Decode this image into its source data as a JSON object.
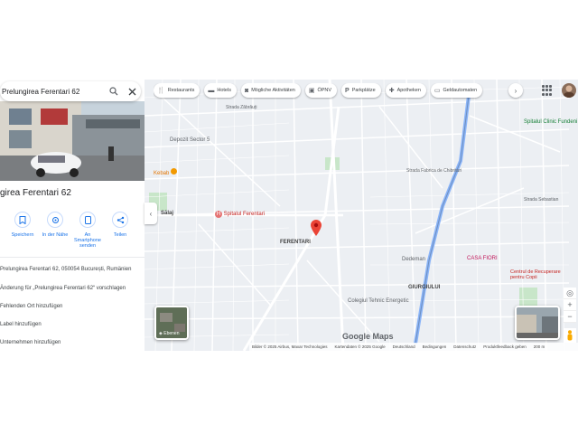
{
  "search": {
    "query": "Prelungirea Ferentari 62"
  },
  "place": {
    "title": "Prelungirea Ferentari 62",
    "title_visible": "girea Ferentari 62"
  },
  "actions": [
    {
      "label": "Speichern",
      "icon": "bookmark-icon"
    },
    {
      "label": "In der Nähe",
      "icon": "nearby-icon"
    },
    {
      "label": "An Smartphone senden",
      "icon": "send-to-phone-icon"
    },
    {
      "label": "Teilen",
      "icon": "share-icon"
    }
  ],
  "info": {
    "address": "Prelungirea Ferentari 62, 050054 București, Rumänien",
    "suggest_edit": "Änderung für „Prelungirea Ferentari 62“ vorschlagen",
    "add_missing": "Fehlenden Ort hinzufügen",
    "add_label": "Label hinzufügen",
    "add_business": "Unternehmen hinzufügen"
  },
  "chips": [
    {
      "label": "Restaurants",
      "icon": "fork-knife-icon"
    },
    {
      "label": "Hotels",
      "icon": "bed-icon"
    },
    {
      "label": "Mögliche Aktivitäten",
      "icon": "camera-icon"
    },
    {
      "label": "ÖPNV",
      "icon": "transit-icon"
    },
    {
      "label": "Parkplätze",
      "icon": "parking-icon"
    },
    {
      "label": "Apotheken",
      "icon": "pharmacy-icon"
    },
    {
      "label": "Geldautomaten",
      "icon": "atm-icon"
    }
  ],
  "map": {
    "labels": [
      {
        "text": "Spitalul Clinic Fundeni",
        "name": "poi"
      },
      {
        "text": "Sălaj",
        "name": "area"
      },
      {
        "text": "FERENTARI",
        "name": "area"
      },
      {
        "text": "GIURGIULUI",
        "name": "area"
      },
      {
        "text": "Spitalul Ferentari",
        "name": "hospital"
      },
      {
        "text": "Școala Gimnazială nr. 136",
        "name": "school"
      },
      {
        "text": "Colegiul Tehnic Energetic",
        "name": "school"
      },
      {
        "text": "CASA FIORI",
        "name": "poi"
      },
      {
        "text": "Centrul de Recuperare pentru Copii",
        "name": "poi"
      },
      {
        "text": "Dedeman",
        "name": "poi"
      },
      {
        "text": "Kebab",
        "name": "poi"
      },
      {
        "text": "Depozit Sector 5",
        "name": "poi"
      }
    ],
    "layers_label": "Ebenen",
    "google": "Google Maps"
  },
  "footer": {
    "items": [
      "Bilder © 2025 Airbus, Maxar Technologies",
      "Kartendaten © 2025 Google",
      "Deutschland",
      "Bedingungen",
      "Datenschutz",
      "Produktfeedback geben",
      "200 m"
    ]
  },
  "colors": {
    "accent": "#1a73e8",
    "pin": "#ea4335",
    "road_major": "#8ab4f8",
    "road": "#ffffff",
    "park": "#c8e6c9"
  }
}
